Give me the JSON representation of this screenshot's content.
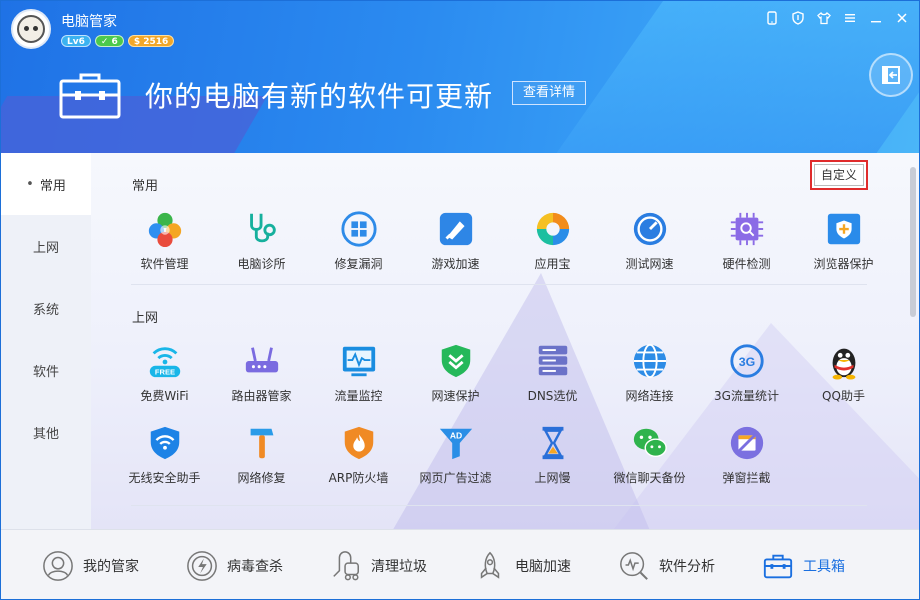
{
  "app": {
    "title": "电脑管家",
    "level": "Lv6",
    "vip": "✓ 6",
    "coins": "$ 2516"
  },
  "banner": {
    "headline": "你的电脑有新的软件可更新",
    "detail_label": "查看详情"
  },
  "custom_label": "自定义",
  "leftnav": {
    "items": [
      {
        "label": "常用"
      },
      {
        "label": "上网"
      },
      {
        "label": "系统"
      },
      {
        "label": "软件"
      },
      {
        "label": "其他"
      }
    ]
  },
  "sections": {
    "common": {
      "title": "常用",
      "tools": [
        {
          "label": "软件管理",
          "icon": "clover-icon",
          "color": "#37b24d"
        },
        {
          "label": "电脑诊所",
          "icon": "stethoscope-icon",
          "color": "#19b3a0"
        },
        {
          "label": "修复漏洞",
          "icon": "windows-repair-icon",
          "color": "#2e8be8"
        },
        {
          "label": "游戏加速",
          "icon": "game-boost-icon",
          "color": "#2e86e6"
        },
        {
          "label": "应用宝",
          "icon": "app-store-icon",
          "color": "#f28c1b"
        },
        {
          "label": "测试网速",
          "icon": "speedometer-icon",
          "color": "#2a7de1"
        },
        {
          "label": "硬件检测",
          "icon": "chip-icon",
          "color": "#8b6be6"
        },
        {
          "label": "浏览器保护",
          "icon": "browser-shield-icon",
          "color": "#2a8bea"
        }
      ]
    },
    "internet": {
      "title": "上网",
      "tools_row1": [
        {
          "label": "免费WiFi",
          "icon": "wifi-free-icon",
          "color": "#19b6e8"
        },
        {
          "label": "路由器管家",
          "icon": "router-icon",
          "color": "#7a6be0"
        },
        {
          "label": "流量监控",
          "icon": "traffic-monitor-icon",
          "color": "#1a8de0"
        },
        {
          "label": "网速保护",
          "icon": "shield-speed-icon",
          "color": "#25b85a"
        },
        {
          "label": "DNS选优",
          "icon": "dns-server-icon",
          "color": "#6b72c8"
        },
        {
          "label": "网络连接",
          "icon": "globe-icon",
          "color": "#2d8ce6"
        },
        {
          "label": "3G流量统计",
          "icon": "3g-icon",
          "color": "#2a7de1"
        },
        {
          "label": "QQ助手",
          "icon": "qq-penguin-icon",
          "color": "#222222"
        }
      ],
      "tools_row2": [
        {
          "label": "无线安全助手",
          "icon": "wifi-shield-icon",
          "color": "#1d83e6"
        },
        {
          "label": "网络修复",
          "icon": "hammer-icon",
          "color": "#2a9be8"
        },
        {
          "label": "ARP防火墙",
          "icon": "firewall-icon",
          "color": "#f08a24"
        },
        {
          "label": "网页广告过滤",
          "icon": "ad-filter-icon",
          "color": "#2a8ee6"
        },
        {
          "label": "上网慢",
          "icon": "hourglass-icon",
          "color": "#2a6fd8"
        },
        {
          "label": "微信聊天备份",
          "icon": "wechat-icon",
          "color": "#2fb34d"
        },
        {
          "label": "弹窗拦截",
          "icon": "popup-block-icon",
          "color": "#7b70e0"
        }
      ]
    }
  },
  "bottomnav": {
    "items": [
      {
        "label": "我的管家",
        "icon": "butler-icon"
      },
      {
        "label": "病毒查杀",
        "icon": "virus-scan-icon"
      },
      {
        "label": "清理垃圾",
        "icon": "vacuum-icon"
      },
      {
        "label": "电脑加速",
        "icon": "rocket-icon"
      },
      {
        "label": "软件分析",
        "icon": "analysis-icon"
      },
      {
        "label": "工具箱",
        "icon": "toolbox-icon"
      }
    ]
  }
}
